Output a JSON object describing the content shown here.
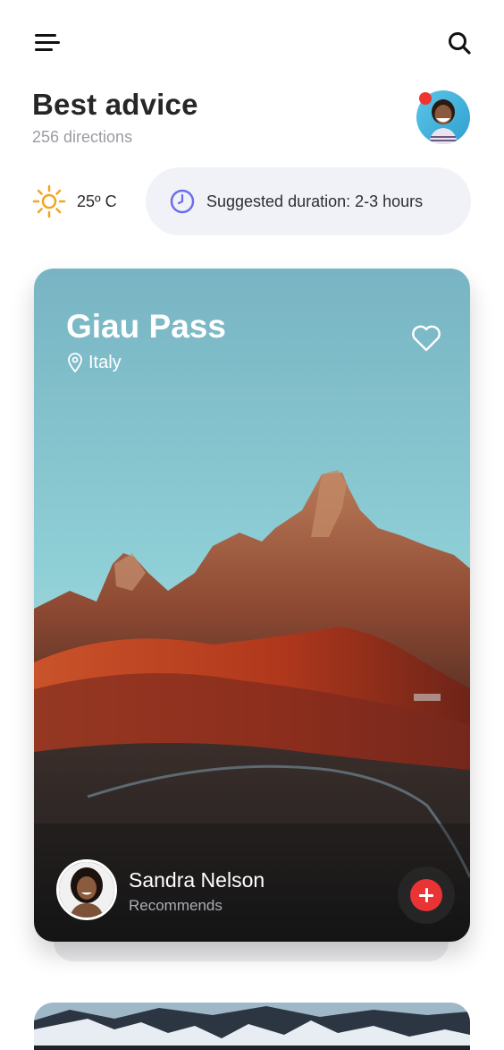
{
  "header": {
    "menu_icon": "hamburger-menu-icon",
    "search_icon": "search-icon",
    "title": "Best advice",
    "subtitle": "256 directions",
    "notification_color": "#f0342e"
  },
  "info": {
    "weather_icon": "sun-icon",
    "temperature": "25º C",
    "duration_icon": "clock-icon",
    "duration_text": "Suggested duration: 2-3 hours"
  },
  "featured_card": {
    "place_name": "Giau Pass",
    "location": "Italy",
    "favorite_icon": "heart-outline-icon",
    "recommender_name": "Sandra Nelson",
    "recommender_label": "Recommends",
    "add_icon": "plus-icon",
    "accent_color": "#ea3335"
  }
}
